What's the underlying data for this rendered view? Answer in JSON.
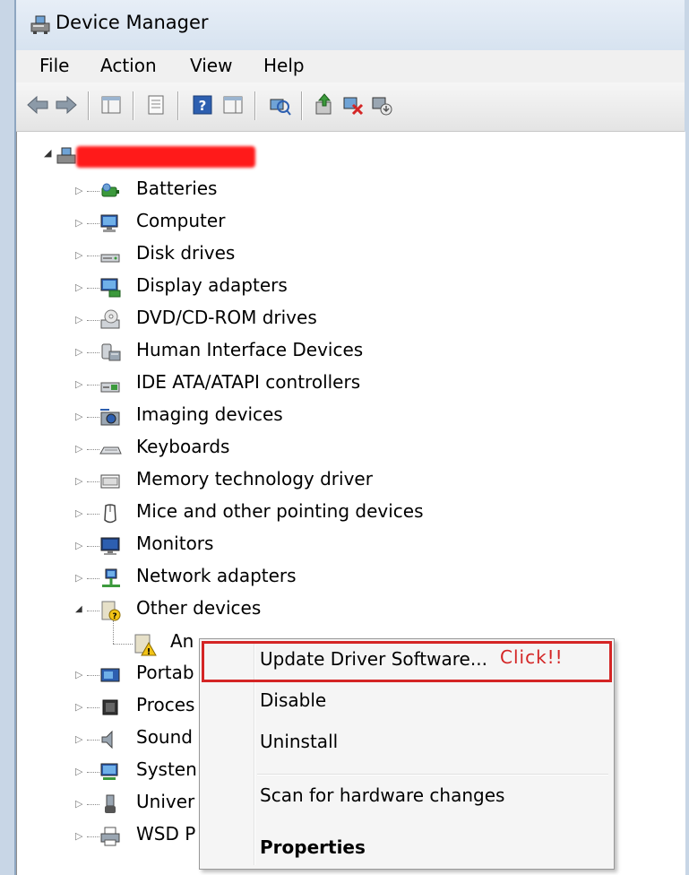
{
  "window": {
    "title": "Device Manager"
  },
  "menu": [
    "File",
    "Action",
    "View",
    "Help"
  ],
  "toolbar": {
    "buttons": [
      "back-icon",
      "forward-icon",
      "show-hide-console-tree-icon",
      "properties-icon",
      "help-icon",
      "show-hide-action-pane-icon",
      "scan-hardware-icon",
      "update-driver-icon",
      "uninstall-icon",
      "disable-icon"
    ]
  },
  "tree": {
    "root_label_redacted": true,
    "categories": [
      {
        "label": "Batteries",
        "icon": "battery-icon"
      },
      {
        "label": "Computer",
        "icon": "computer-icon"
      },
      {
        "label": "Disk drives",
        "icon": "disk-drive-icon"
      },
      {
        "label": "Display adapters",
        "icon": "display-adapter-icon"
      },
      {
        "label": "DVD/CD-ROM drives",
        "icon": "dvd-drive-icon"
      },
      {
        "label": "Human Interface Devices",
        "icon": "hid-icon"
      },
      {
        "label": "IDE ATA/ATAPI controllers",
        "icon": "ide-controller-icon"
      },
      {
        "label": "Imaging devices",
        "icon": "camera-icon"
      },
      {
        "label": "Keyboards",
        "icon": "keyboard-icon"
      },
      {
        "label": "Memory technology driver",
        "icon": "memory-icon"
      },
      {
        "label": "Mice and other pointing devices",
        "icon": "mouse-icon"
      },
      {
        "label": "Monitors",
        "icon": "monitor-icon"
      },
      {
        "label": "Network adapters",
        "icon": "network-adapter-icon"
      },
      {
        "label": "Other devices",
        "icon": "unknown-device-icon",
        "expanded": true
      },
      {
        "label": "Portab",
        "icon": "portable-device-icon"
      },
      {
        "label": "Proces",
        "icon": "processor-icon"
      },
      {
        "label": "Sound",
        "icon": "speaker-icon"
      },
      {
        "label": "Systen",
        "icon": "system-device-icon"
      },
      {
        "label": "Univer",
        "icon": "usb-icon"
      },
      {
        "label": "WSD P",
        "icon": "printer-icon"
      }
    ],
    "other_devices_child": {
      "label": "An",
      "icon": "warning-device-icon"
    }
  },
  "context_menu": {
    "items": [
      {
        "label": "Update Driver Software...",
        "bold": false
      },
      {
        "label": "Disable",
        "bold": false
      },
      {
        "label": "Uninstall",
        "bold": false
      },
      {
        "label": "Scan for hardware changes",
        "bold": false
      },
      {
        "label": "Properties",
        "bold": true
      }
    ],
    "annotation": "Click!!"
  },
  "colors": {
    "annotation": "#d42525",
    "redaction": "#ff1a1a",
    "title_bar": "#dbe6f2"
  }
}
